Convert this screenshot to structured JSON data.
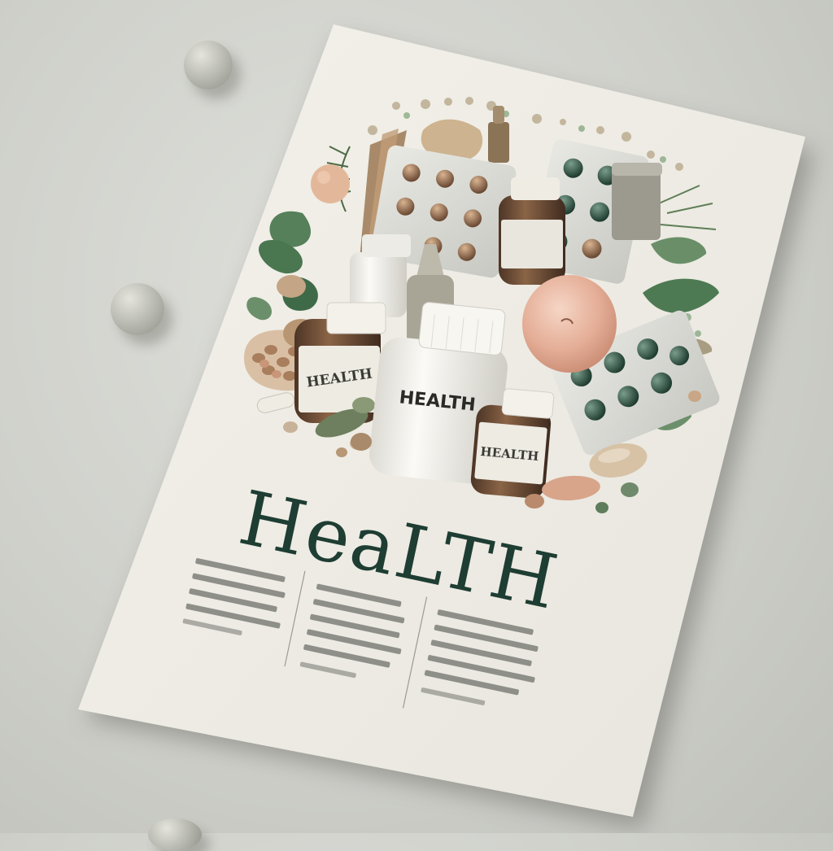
{
  "poster": {
    "headline": "HeaLTH",
    "bottle_main_label": "HEALTH",
    "bottle_left_label": "HEALTH",
    "bottle_right_label": "HEALTH"
  },
  "colors": {
    "background": "#cfd0ca",
    "paper": "#efede6",
    "headline": "#1e3d33",
    "leaf": "#4f7650",
    "apple": "#e6b39b",
    "amber_bottle": "#6a4a36",
    "pill_green": "#345a48"
  },
  "icons": [
    "stone-icon",
    "pill-icon",
    "leaf-icon",
    "apple-icon",
    "bottle-icon",
    "blister-pack-icon"
  ]
}
